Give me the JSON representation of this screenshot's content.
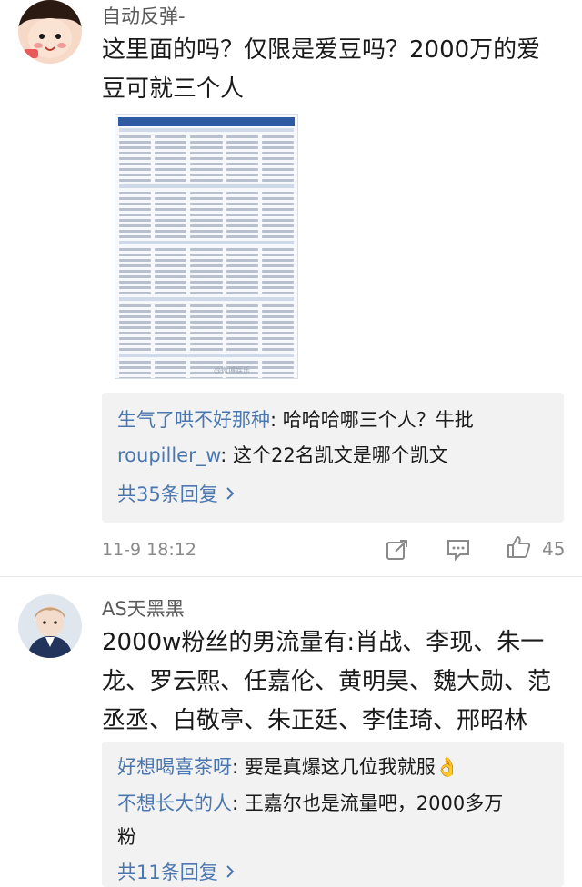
{
  "comments": [
    {
      "username": "自动反弹-",
      "text_line1": "这里面的吗？仅限是爱豆吗？2000万的爱",
      "text_line2": "豆可就三个人",
      "image_watermark": "@微博娱乐",
      "replies": [
        {
          "user": "生气了哄不好那种",
          "sep": ": ",
          "text": "哈哈哈哪三个人？牛批"
        },
        {
          "user": "roupiller_w",
          "sep": ": ",
          "text": "这个22名凯文是哪个凯文"
        }
      ],
      "more_replies": "共35条回复",
      "time": "11-9 18:12",
      "like_count": "45"
    },
    {
      "username": "AS天黑黑",
      "text_line1": "2000w粉丝的男流量有:肖战、李现、朱一",
      "text_line2": "龙、罗云熙、任嘉伦、黄明昊、魏大勋、范",
      "text_line3": "丞丞、白敬亭、朱正廷、李佳琦、邢昭林",
      "replies": [
        {
          "user": "好想喝喜茶呀",
          "sep": ": ",
          "text": "要是真爆这几位我就服👌"
        },
        {
          "user": "不想长大的人",
          "sep": ": ",
          "text": "王嘉尔也是流量吧，2000多万",
          "text2": "粉"
        }
      ],
      "more_replies": "共11条回复"
    }
  ],
  "icons": {
    "more_chevron": "chevron-right-icon",
    "share": "share-icon",
    "comment": "comment-icon",
    "like": "like-icon"
  },
  "colors": {
    "link_blue": "#4a77b0",
    "reply_bg": "#f2f2f2",
    "meta_gray": "#8a8a8a"
  }
}
